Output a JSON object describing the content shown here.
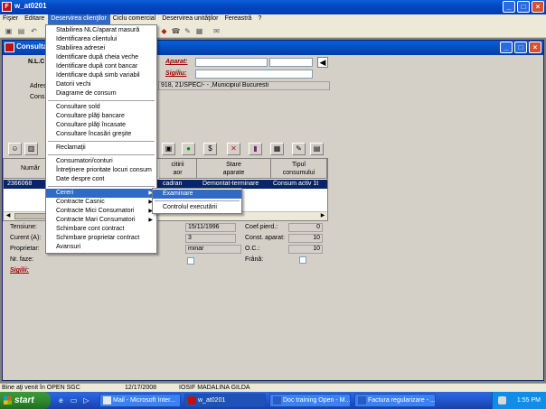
{
  "app": {
    "title": "w_at0201",
    "icon_label": "F"
  },
  "menubar": {
    "items": [
      "Fişier",
      "Editare",
      "Deservirea clienţilor",
      "Ciclu comercial",
      "Deservirea unităţilor",
      "Fereastră",
      "?"
    ],
    "active": "Deservirea clienţilor"
  },
  "child": {
    "title": "Consulta",
    "nlc_label": "N.L.C",
    "aparat_label": "Aparat:",
    "sigiliu_label": "Sigiliu:",
    "adresa_label": "Adres",
    "adresa_value": "918, 21/SPEC/- - ,Municipiul Bucuresti",
    "cons_label": "Cons",
    "grid_headers": [
      "Număr",
      "citirii\naor",
      "Stare\naparate",
      "Tipul\nconsumului"
    ],
    "grid_row": {
      "numar": "2366068",
      "cadran": "cadran",
      "stare": "Demontat-terminare",
      "tip": "Consum activ 1t"
    },
    "tensiune_label": "Tensiune:",
    "curent_label": "Curent (A):",
    "proprietar_label": "Proprietar:",
    "faze_label": "Nr. faze:",
    "sigilii_label": "Sigilii:",
    "date_value": "15/11/1996",
    "num_value": "3",
    "status_value": "minar",
    "coef_label": "Coef.pierd.:",
    "coef_value": "0",
    "const_label": "Const. aparat:",
    "const_value": "10",
    "oc_label": "O.C.:",
    "oc_value": "10",
    "frana_label": "Frână:"
  },
  "menu_main": {
    "items": [
      "Stabilirea NLC/aparat masură",
      "Identificarea clientului",
      "Stabilirea adresei",
      "Identificare după cheia veche",
      "Identificare după cont bancar",
      "Identificare după simb variabil",
      "Datorii vechi",
      "Diagrame de consum",
      "Consultare sold",
      "Consultare plăţi bancare",
      "Consultare plăţi încasate",
      "Consultare încasări greşite",
      "Reclamaţii",
      "Consumatori/conturi",
      "Întreţinere prioritate locuri consum",
      "Date despre cont",
      "Cereri",
      "Contracte Casnic",
      "Contracte Mici Consumatori",
      "Contracte Mari Consumatori",
      "Schimbare cont contract",
      "Schimbare proprietar contract",
      "Avansuri"
    ],
    "highlighted": "Cereri"
  },
  "menu_sub": {
    "items": [
      "Examinare",
      "Controlul executării"
    ],
    "highlighted": "Examinare"
  },
  "statusbar": {
    "message": "Bine aţi venit în OPEN SGC",
    "date": "12/17/2008",
    "user": "IOSIF MADALINA GILDA"
  },
  "taskbar": {
    "start_label": "start",
    "tasks": [
      "Mail - Microsoft Inter...",
      "w_at0201",
      "Doc training Open - M...",
      "Factura regularizare - ..."
    ],
    "active_task": "w_at0201",
    "clock": "1:55 PM"
  },
  "colors": {
    "titlebar": "#0548c4",
    "highlight": "#316ac5",
    "grid_selection": "#0a246a",
    "label_red": "#9c0000"
  }
}
